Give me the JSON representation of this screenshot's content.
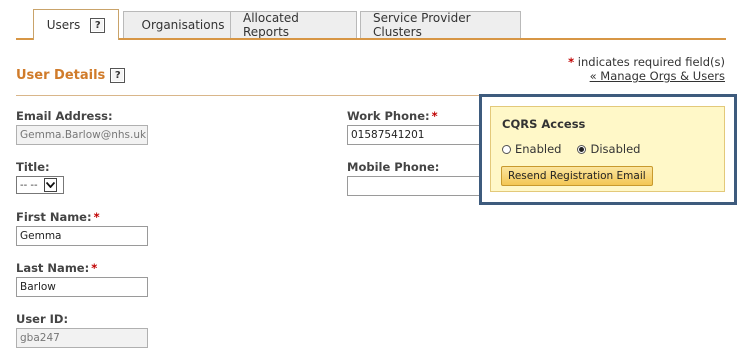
{
  "tabs": [
    {
      "label": "Users",
      "active": true
    },
    {
      "label": "Organisations",
      "active": false
    },
    {
      "label": "Allocated Reports",
      "active": false
    },
    {
      "label": "Service Provider Clusters",
      "active": false
    }
  ],
  "help_glyph": "?",
  "required_note": {
    "star": "*",
    "text": "indicates required field(s)"
  },
  "manage_link": "« Manage Orgs & Users",
  "section_title": "User Details",
  "fields": {
    "email": {
      "label": "Email Address:",
      "value": "Gemma.Barlow@nhs.uk"
    },
    "title": {
      "label": "Title:",
      "value": "-- --"
    },
    "first_name": {
      "label": "First Name:",
      "required": "*",
      "value": "Gemma"
    },
    "last_name": {
      "label": "Last Name:",
      "required": "*",
      "value": "Barlow"
    },
    "user_id": {
      "label": "User ID:",
      "value": "gba247"
    },
    "work_phone": {
      "label": "Work Phone:",
      "required": "*",
      "value": "01587541201"
    },
    "mobile_phone": {
      "label": "Mobile Phone:",
      "value": ""
    }
  },
  "cqrs": {
    "title": "CQRS Access",
    "enabled_label": "Enabled",
    "disabled_label": "Disabled",
    "selected": "Disabled",
    "resend_button": "Resend Registration Email"
  },
  "colors": {
    "accent_orange": "#d07b2a",
    "tab_line": "#d79645",
    "highlight_border": "#3e5b7d",
    "panel_bg": "#fff8c8",
    "required_star": "#c00000"
  }
}
